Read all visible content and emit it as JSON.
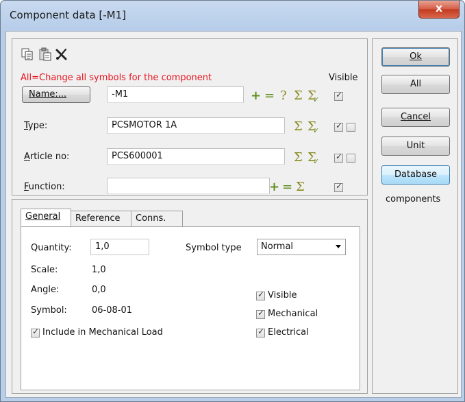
{
  "window": {
    "title": "Component data [-M1]",
    "close_symbol": "x"
  },
  "toolbar": {
    "icons": [
      "copy-icon",
      "paste-icon",
      "delete-icon"
    ]
  },
  "hint_text": "All=Change all symbols for the component",
  "visible_header": "Visible",
  "name_button": "Name:...",
  "fields": {
    "name": {
      "value": "-M1"
    },
    "type": {
      "label": "Type:",
      "value": "PCSMOTOR 1A"
    },
    "article": {
      "label": "Article no:",
      "value": "PCS600001"
    },
    "function": {
      "label": "Function:",
      "value": ""
    }
  },
  "symbols": {
    "plus": "+",
    "minus": "=",
    "question": "?",
    "sigma": "Σ",
    "sigma_check": "Σ"
  },
  "checkboxes": {
    "name_visible": true,
    "type_visible": true,
    "type_extra": false,
    "article_visible": true,
    "article_extra": false,
    "function_visible": true
  },
  "side_buttons": {
    "ok": "Ok",
    "all": "All",
    "cancel": "Cancel",
    "unit": "Unit",
    "database": "Database",
    "components_label": "components"
  },
  "tabs": [
    "General",
    "Reference",
    "Conns."
  ],
  "general": {
    "quantity_label": "Quantity:",
    "quantity_value": "1,0",
    "symbol_type_label": "Symbol type",
    "symbol_type_value": "Normal",
    "scale_label": "Scale:",
    "scale_value": "1,0",
    "angle_label": "Angle:",
    "angle_value": "0,0",
    "symbol_label": "Symbol:",
    "symbol_value": "06-08-01",
    "include_load_label": "Include in Mechanical Load",
    "include_load_checked": true,
    "visible_label": "Visible",
    "visible_checked": true,
    "mechanical_label": "Mechanical",
    "mechanical_checked": true,
    "electrical_label": "Electrical",
    "electrical_checked": true
  },
  "colors": {
    "hint_red": "#e8141e",
    "plus_green": "#5f8f1e",
    "sigma_olive": "#8a8a20",
    "frame_blue": "#b9cfe9"
  }
}
